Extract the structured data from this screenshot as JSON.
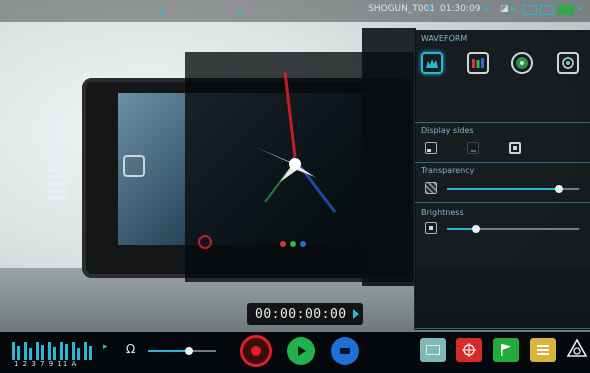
{
  "topbar": {
    "clip_name": "SHOGUN_T001",
    "record_time": "01:30:09",
    "accent": "#27b8d6"
  },
  "panel": {
    "waveform_title": "WAVEFORM",
    "display_sides_title": "Display sides",
    "transparency_title": "Transparency",
    "brightness_title": "Brightness",
    "transparency_value": 0.85,
    "brightness_value": 0.22,
    "modes": [
      {
        "icon": "waveform-luma-icon",
        "selected": true
      },
      {
        "icon": "waveform-rgb-parade-icon",
        "selected": false
      },
      {
        "icon": "vectorscope-icon",
        "selected": false
      },
      {
        "icon": "vectorscope-zoom-icon",
        "selected": false
      }
    ]
  },
  "timecode": {
    "value": "00:00:00:00"
  },
  "bottombar": {
    "audio_channels_label": "1 2 3 7 9 11 A",
    "headphone_volume": 0.6
  },
  "colors": {
    "record": "#e11d2b",
    "play": "#22b24c",
    "stop_blue": "#1f6fd6",
    "green_tool": "#23a93c",
    "yellow_tool": "#d9b43a",
    "teal_tool": "#7fb8b7",
    "red_tool": "#d72a2a"
  }
}
